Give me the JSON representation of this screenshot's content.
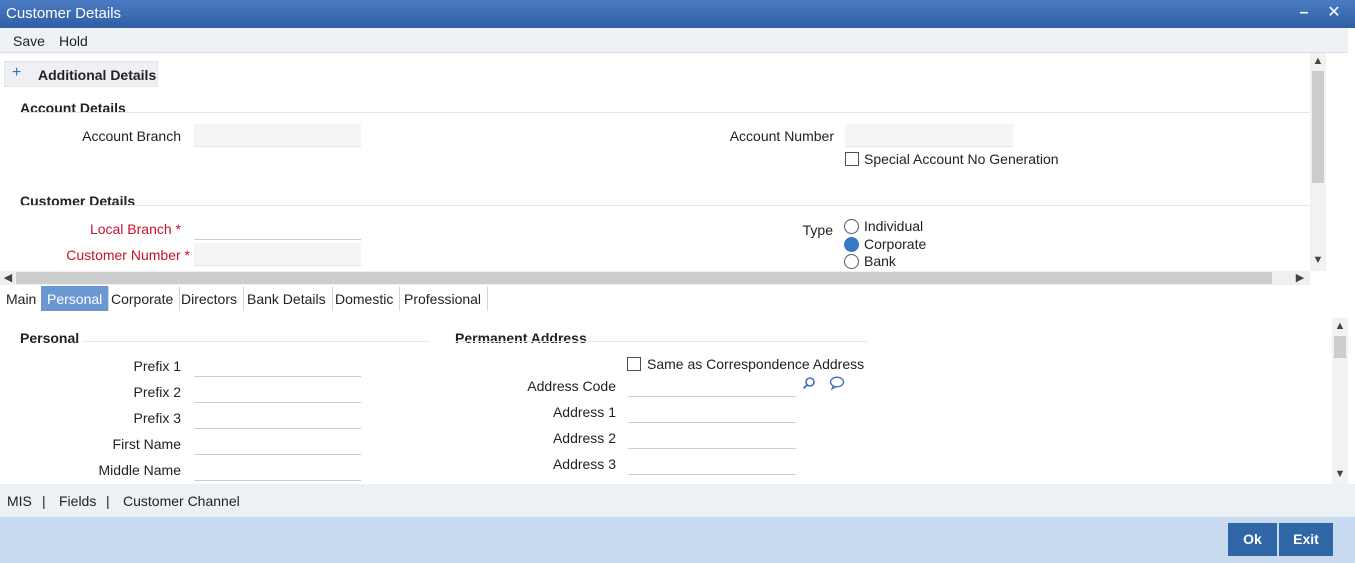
{
  "window": {
    "title": "Customer Details"
  },
  "toolbar": {
    "save": "Save",
    "hold": "Hold"
  },
  "additional": {
    "label": "Additional Details"
  },
  "account_section": {
    "heading": "Account Details",
    "branch_label": "Account Branch",
    "branch_value": "",
    "number_label": "Account Number",
    "number_value": "",
    "special_label": "Special Account No Generation",
    "special_checked": false
  },
  "customer_section": {
    "heading": "Customer Details",
    "local_branch_label": "Local Branch",
    "customer_number_label": "Customer Number",
    "required_mark": "*",
    "type_label": "Type",
    "type_options": [
      "Individual",
      "Corporate",
      "Bank"
    ],
    "type_selected": "Corporate"
  },
  "tabs": [
    "Main",
    "Personal",
    "Corporate",
    "Directors",
    "Bank Details",
    "Domestic",
    "Professional"
  ],
  "active_tab": "Personal",
  "personal": {
    "heading": "Personal",
    "fields": [
      "Prefix 1",
      "Prefix 2",
      "Prefix 3",
      "First Name",
      "Middle Name"
    ]
  },
  "permanent": {
    "heading": "Permanent Address",
    "same_label": "Same as Correspondence Address",
    "same_checked": false,
    "fields": [
      "Address Code",
      "Address 1",
      "Address 2",
      "Address 3"
    ]
  },
  "bottom_links": {
    "mis": "MIS",
    "fields": "Fields",
    "channel": "Customer Channel",
    "separator": "|"
  },
  "footer": {
    "ok": "Ok",
    "exit": "Exit"
  },
  "icons": {
    "add": "plus-icon",
    "search": "search-icon",
    "comment": "comment-icon",
    "minimize": "minimize-icon",
    "close": "close-icon"
  },
  "colors": {
    "titlebar": "#2f5ea5",
    "accent": "#3a78c2",
    "required": "#c8102e",
    "footer": "#c7daf0",
    "button": "#2e66a6",
    "active_tab": "#6b97d2"
  }
}
